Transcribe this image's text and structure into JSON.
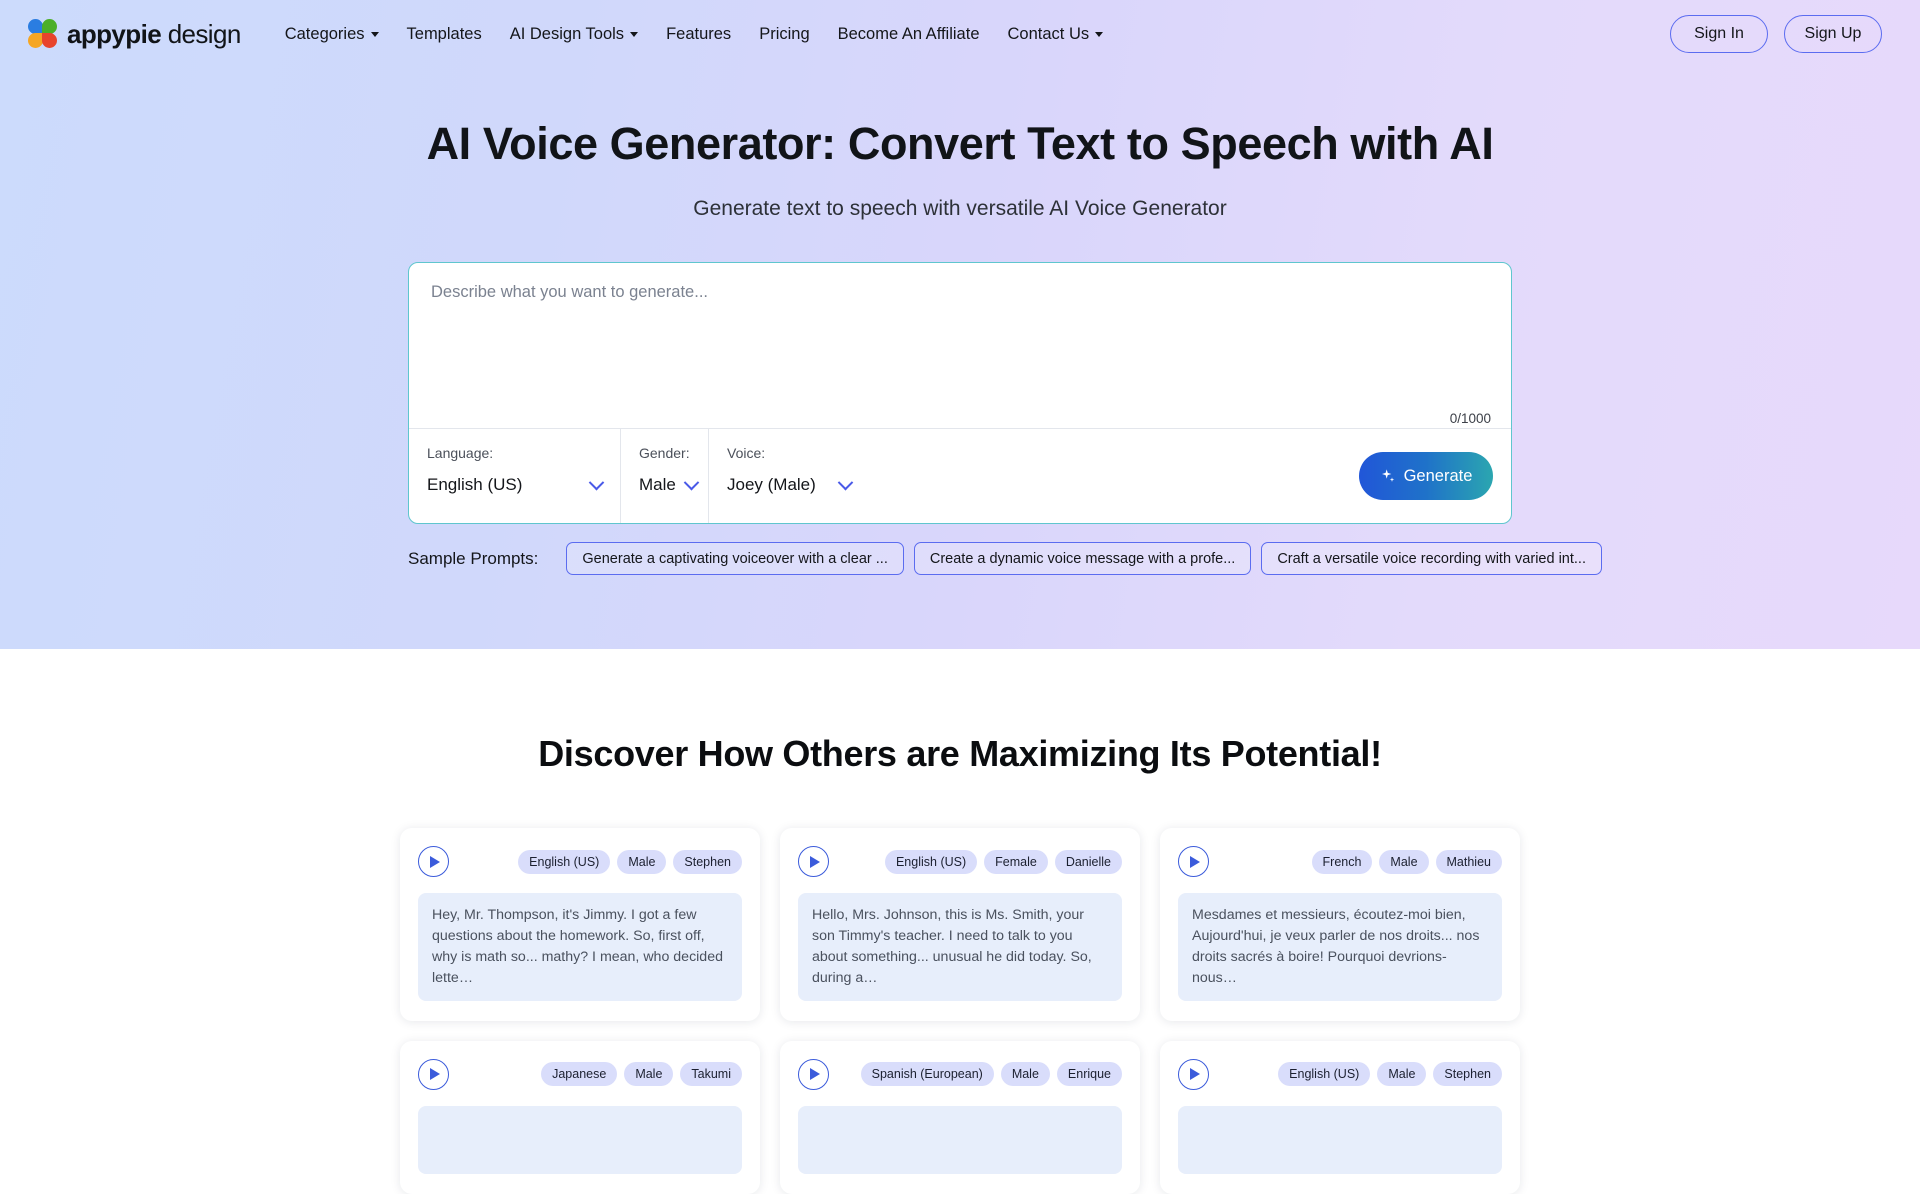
{
  "nav": {
    "brand_bold": "appypie",
    "brand_light": "design",
    "logo_icon": "appypie-flower-logo",
    "links": [
      {
        "label": "Categories",
        "has_caret": true
      },
      {
        "label": "Templates",
        "has_caret": false
      },
      {
        "label": "AI Design Tools",
        "has_caret": true
      },
      {
        "label": "Features",
        "has_caret": false
      },
      {
        "label": "Pricing",
        "has_caret": false
      },
      {
        "label": "Become An Affiliate",
        "has_caret": false
      },
      {
        "label": "Contact Us",
        "has_caret": true
      }
    ],
    "sign_in": "Sign In",
    "sign_up": "Sign Up"
  },
  "hero": {
    "title": "AI Voice Generator: Convert Text to Speech with AI",
    "subtitle": "Generate text to speech with versatile AI Voice Generator"
  },
  "generator": {
    "placeholder": "Describe what you want to generate...",
    "value": "",
    "char_count": "0/1000",
    "language_label": "Language:",
    "language_value": "English (US)",
    "gender_label": "Gender:",
    "gender_value": "Male",
    "voice_label": "Voice:",
    "voice_value": "Joey (Male)",
    "generate_label": "Generate",
    "generate_icon": "sparkle-icon",
    "border_color": "#5fc6ce",
    "button_gradient_from": "#2156d8",
    "button_gradient_to": "#2ba6b0"
  },
  "samples": {
    "label": "Sample Prompts:",
    "items": [
      "Generate a captivating voiceover with a clear ...",
      "Create a dynamic voice message with a profe...",
      "Craft a versatile voice recording with varied int..."
    ]
  },
  "showcase": {
    "title": "Discover How Others are Maximizing Its Potential!",
    "cards": [
      {
        "play_icon": "play-icon",
        "tags": [
          "English (US)",
          "Male",
          "Stephen"
        ],
        "text": "Hey, Mr. Thompson, it's Jimmy. I got a few questions about the homework. So, first off, why is math so... mathy? I mean, who decided lette…"
      },
      {
        "play_icon": "play-icon",
        "tags": [
          "English (US)",
          "Female",
          "Danielle"
        ],
        "text": "Hello, Mrs. Johnson, this is Ms. Smith, your son Timmy's teacher. I need to talk to you about something... unusual he did today. So, during a…"
      },
      {
        "play_icon": "play-icon",
        "tags": [
          "French",
          "Male",
          "Mathieu"
        ],
        "text": "Mesdames et messieurs, écoutez-moi bien, Aujourd'hui, je veux parler de nos droits... nos droits sacrés à boire! Pourquoi devrions-nous…"
      },
      {
        "play_icon": "play-icon",
        "tags": [
          "Japanese",
          "Male",
          "Takumi"
        ],
        "text": ""
      },
      {
        "play_icon": "play-icon",
        "tags": [
          "Spanish (European)",
          "Male",
          "Enrique"
        ],
        "text": ""
      },
      {
        "play_icon": "play-icon",
        "tags": [
          "English (US)",
          "Male",
          "Stephen"
        ],
        "text": ""
      }
    ]
  }
}
